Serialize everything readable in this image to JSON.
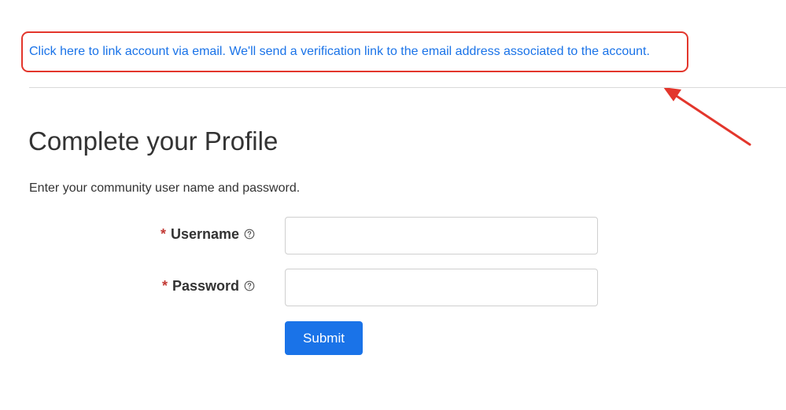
{
  "link": {
    "text": "Click here to link account via email. We'll send a verification link to the email address associated to the account."
  },
  "profile": {
    "title": "Complete your Profile",
    "instructions": "Enter your community user name and password."
  },
  "form": {
    "required_marker": "*",
    "username": {
      "label": "Username",
      "value": "",
      "placeholder": ""
    },
    "password": {
      "label": "Password",
      "value": "",
      "placeholder": ""
    },
    "submit_label": "Submit"
  },
  "colors": {
    "link": "#1a73e8",
    "highlight_box": "#e3362c",
    "arrow": "#e3362c",
    "required": "#c23934",
    "button": "#1a73e8"
  },
  "icons": {
    "help": "question-circle-icon",
    "annotation": "arrow-icon"
  }
}
